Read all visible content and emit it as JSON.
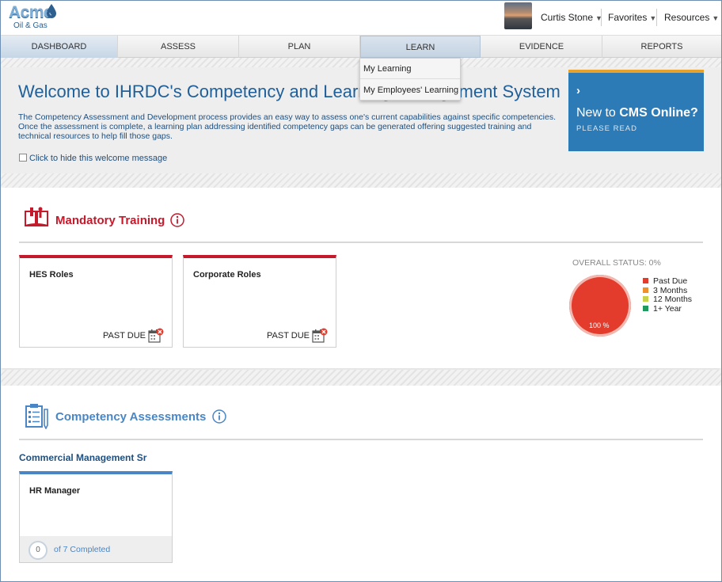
{
  "header": {
    "logo": {
      "name": "Acme",
      "sub": "Oil & Gas"
    },
    "user_name": "Curtis Stone",
    "favorites": "Favorites",
    "resources": "Resources",
    "caret": "▼"
  },
  "nav": {
    "items": [
      {
        "label": "DASHBOARD"
      },
      {
        "label": "ASSESS"
      },
      {
        "label": "PLAN"
      },
      {
        "label": "LEARN"
      },
      {
        "label": "EVIDENCE"
      },
      {
        "label": "REPORTS"
      }
    ]
  },
  "learn_menu": {
    "items": [
      {
        "label": "My Learning"
      },
      {
        "label": "My Employees' Learning"
      }
    ]
  },
  "welcome": {
    "title": "Welcome to IHRDC's Competency and Learning Management System",
    "body": "The Competency Assessment and Development process provides an easy way to assess one's current capabilities against specific competencies. Once the assessment is complete, a learning plan addressing identified competency gaps can be generated offering suggested training and technical resources to help fill those gaps.",
    "hide_label": "Click to hide this welcome message",
    "cms_title_prefix": "New to ",
    "cms_title_bold": "CMS Online?",
    "cms_sub": "PLEASE READ"
  },
  "mandatory": {
    "title": "Mandatory Training",
    "cards": [
      {
        "name": "HES Roles",
        "status": "PAST DUE"
      },
      {
        "name": "Corporate Roles",
        "status": "PAST DUE"
      }
    ],
    "overall_status": "OVERALL STATUS: 0%",
    "pie_label": "100 %",
    "legend": [
      {
        "label": "Past Due",
        "color": "#e33b2c"
      },
      {
        "label": "3 Months",
        "color": "#f0902a"
      },
      {
        "label": "12 Months",
        "color": "#c7d24a"
      },
      {
        "label": "1+ Year",
        "color": "#1f9a5c"
      }
    ]
  },
  "competency": {
    "title": "Competency Assessments",
    "group": "Commercial Management Sr",
    "card_name": "HR Manager",
    "completed_count": "0",
    "completed_label": "of 7 Completed"
  },
  "colors": {
    "mandatory_red": "#c41a2b",
    "competency_blue": "#4a86c5"
  }
}
